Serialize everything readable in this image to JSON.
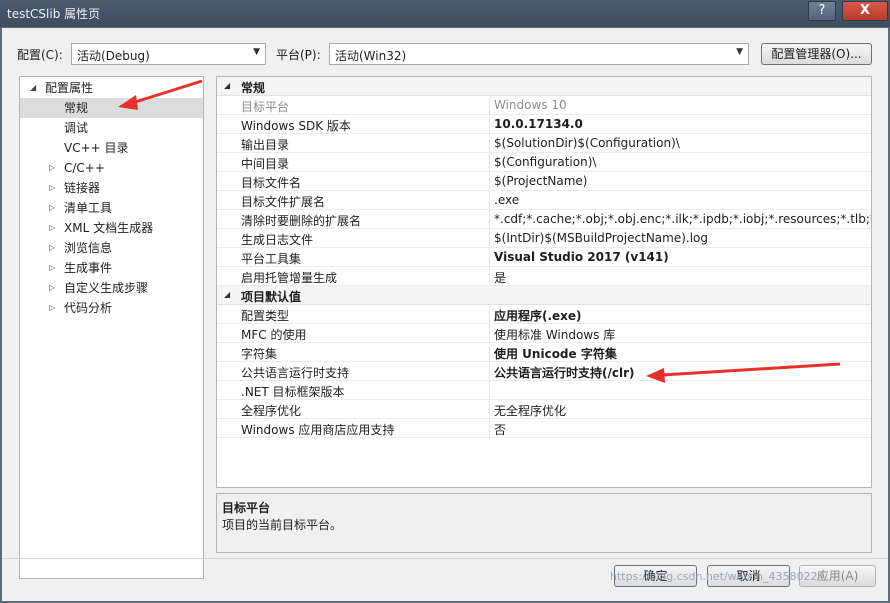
{
  "window": {
    "title": "testCSlib 属性页",
    "help_label": "?",
    "close_label": "X"
  },
  "toolbar": {
    "config_label": "配置(C):",
    "config_value": "活动(Debug)",
    "platform_label": "平台(P):",
    "platform_value": "活动(Win32)",
    "config_manager_label": "配置管理器(O)..."
  },
  "tree": {
    "root_label": "配置属性",
    "items": [
      {
        "label": "常规",
        "selected": true
      },
      {
        "label": "调试"
      },
      {
        "label": "VC++ 目录"
      },
      {
        "label": "C/C++"
      },
      {
        "label": "链接器"
      },
      {
        "label": "清单工具"
      },
      {
        "label": "XML 文档生成器"
      },
      {
        "label": "浏览信息"
      },
      {
        "label": "生成事件"
      },
      {
        "label": "自定义生成步骤"
      },
      {
        "label": "代码分析"
      }
    ]
  },
  "grid": {
    "categories": [
      {
        "name": "常规",
        "rows": [
          {
            "name": "目标平台",
            "value": "Windows 10",
            "style": "grey"
          },
          {
            "name": "Windows SDK 版本",
            "value": "10.0.17134.0",
            "style": "bold"
          },
          {
            "name": "输出目录",
            "value": "$(SolutionDir)$(Configuration)\\"
          },
          {
            "name": "中间目录",
            "value": "$(Configuration)\\"
          },
          {
            "name": "目标文件名",
            "value": "$(ProjectName)"
          },
          {
            "name": "目标文件扩展名",
            "value": ".exe"
          },
          {
            "name": "清除时要删除的扩展名",
            "value": "*.cdf;*.cache;*.obj;*.obj.enc;*.ilk;*.ipdb;*.iobj;*.resources;*.tlb;*.tli;*.t"
          },
          {
            "name": "生成日志文件",
            "value": "$(IntDir)$(MSBuildProjectName).log"
          },
          {
            "name": "平台工具集",
            "value": "Visual Studio 2017 (v141)",
            "style": "bold"
          },
          {
            "name": "启用托管增量生成",
            "value": "是"
          }
        ]
      },
      {
        "name": "项目默认值",
        "rows": [
          {
            "name": "配置类型",
            "value": "应用程序(.exe)",
            "style": "bold"
          },
          {
            "name": "MFC 的使用",
            "value": "使用标准 Windows 库"
          },
          {
            "name": "字符集",
            "value": "使用 Unicode 字符集",
            "style": "bold"
          },
          {
            "name": "公共语言运行时支持",
            "value": "公共语言运行时支持(/clr)",
            "style": "bold"
          },
          {
            "name": ".NET 目标框架版本",
            "value": ""
          },
          {
            "name": "全程序优化",
            "value": "无全程序优化"
          },
          {
            "name": "Windows 应用商店应用支持",
            "value": "否"
          }
        ]
      }
    ]
  },
  "description": {
    "title": "目标平台",
    "body": "项目的当前目标平台。"
  },
  "buttons": {
    "ok": "确定",
    "cancel": "取消",
    "apply": "应用(A)"
  },
  "watermark": "https://blog.csdn.net/weixin_43580224",
  "colors": {
    "annotation_arrow": "#e8312a",
    "selected_bg": "#dcdcdc"
  }
}
